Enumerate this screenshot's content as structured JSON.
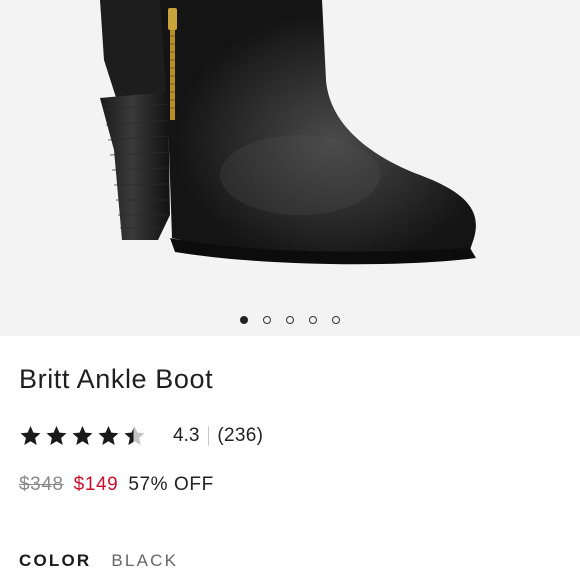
{
  "product": {
    "name": "Britt Ankle Boot",
    "rating": {
      "value": "4.3",
      "stars": 4.3,
      "max_stars": 5,
      "reviews": "(236)"
    },
    "price": {
      "original": "$348",
      "sale": "$149",
      "discount": "57% OFF"
    },
    "color": {
      "label": "COLOR",
      "value": "BLACK"
    }
  },
  "gallery": {
    "image_count": 5,
    "active_index": 0
  },
  "colors": {
    "sale_price": "#c8102e",
    "star_filled": "#1a1a1a",
    "star_empty": "#c4c4c4",
    "image_bg": "#f3f3f3"
  },
  "icons": {
    "star": "star-icon",
    "dot": "carousel-dot"
  }
}
